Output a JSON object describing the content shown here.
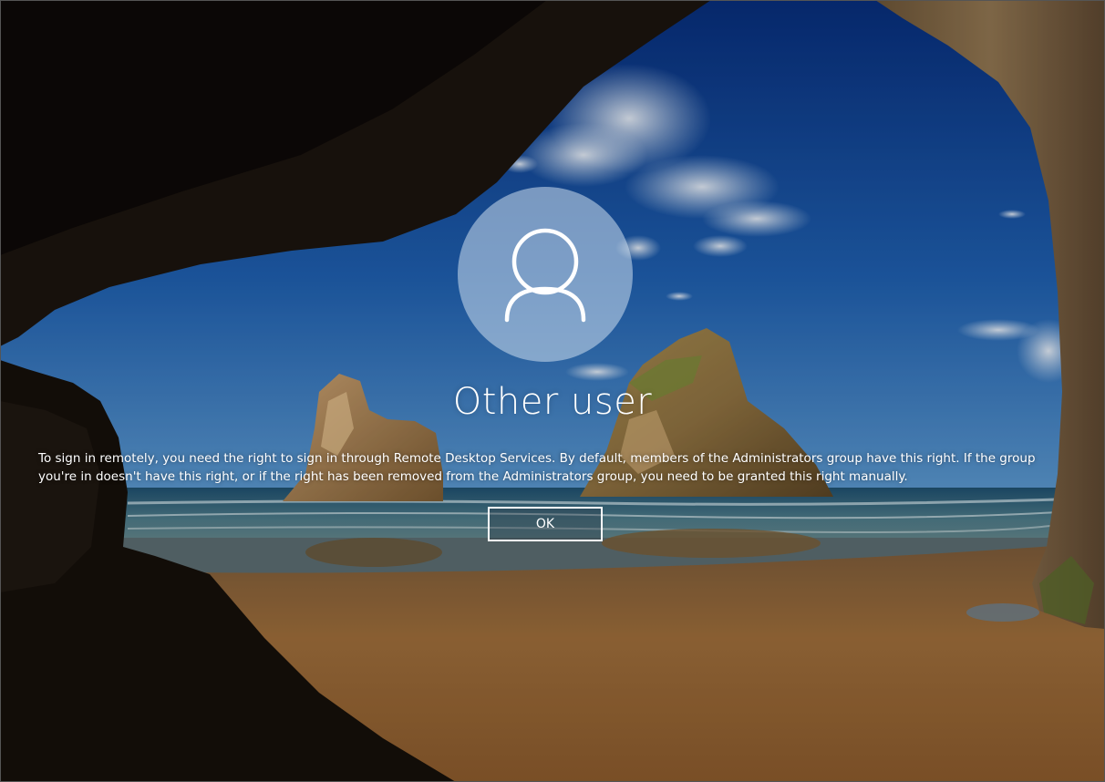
{
  "lock_screen": {
    "username": "Other user",
    "message": "To sign in remotely, you need the right to sign in through Remote Desktop Services. By default, members of the Administrators group have this right. If the group you're in doesn't have this right, or if the right has been removed from the Administrators group, you need to be granted this right manually.",
    "ok_label": "OK",
    "avatar_icon": "user-silhouette-icon",
    "wallpaper": "beach-cave-wallpaper"
  },
  "colors": {
    "sky_top": "#0d3a8c",
    "sky_bottom": "#3f86c4",
    "sand": "#9a6a38",
    "cave": "#140f0b",
    "text": "#ffffff",
    "button_border": "#ffffff"
  }
}
